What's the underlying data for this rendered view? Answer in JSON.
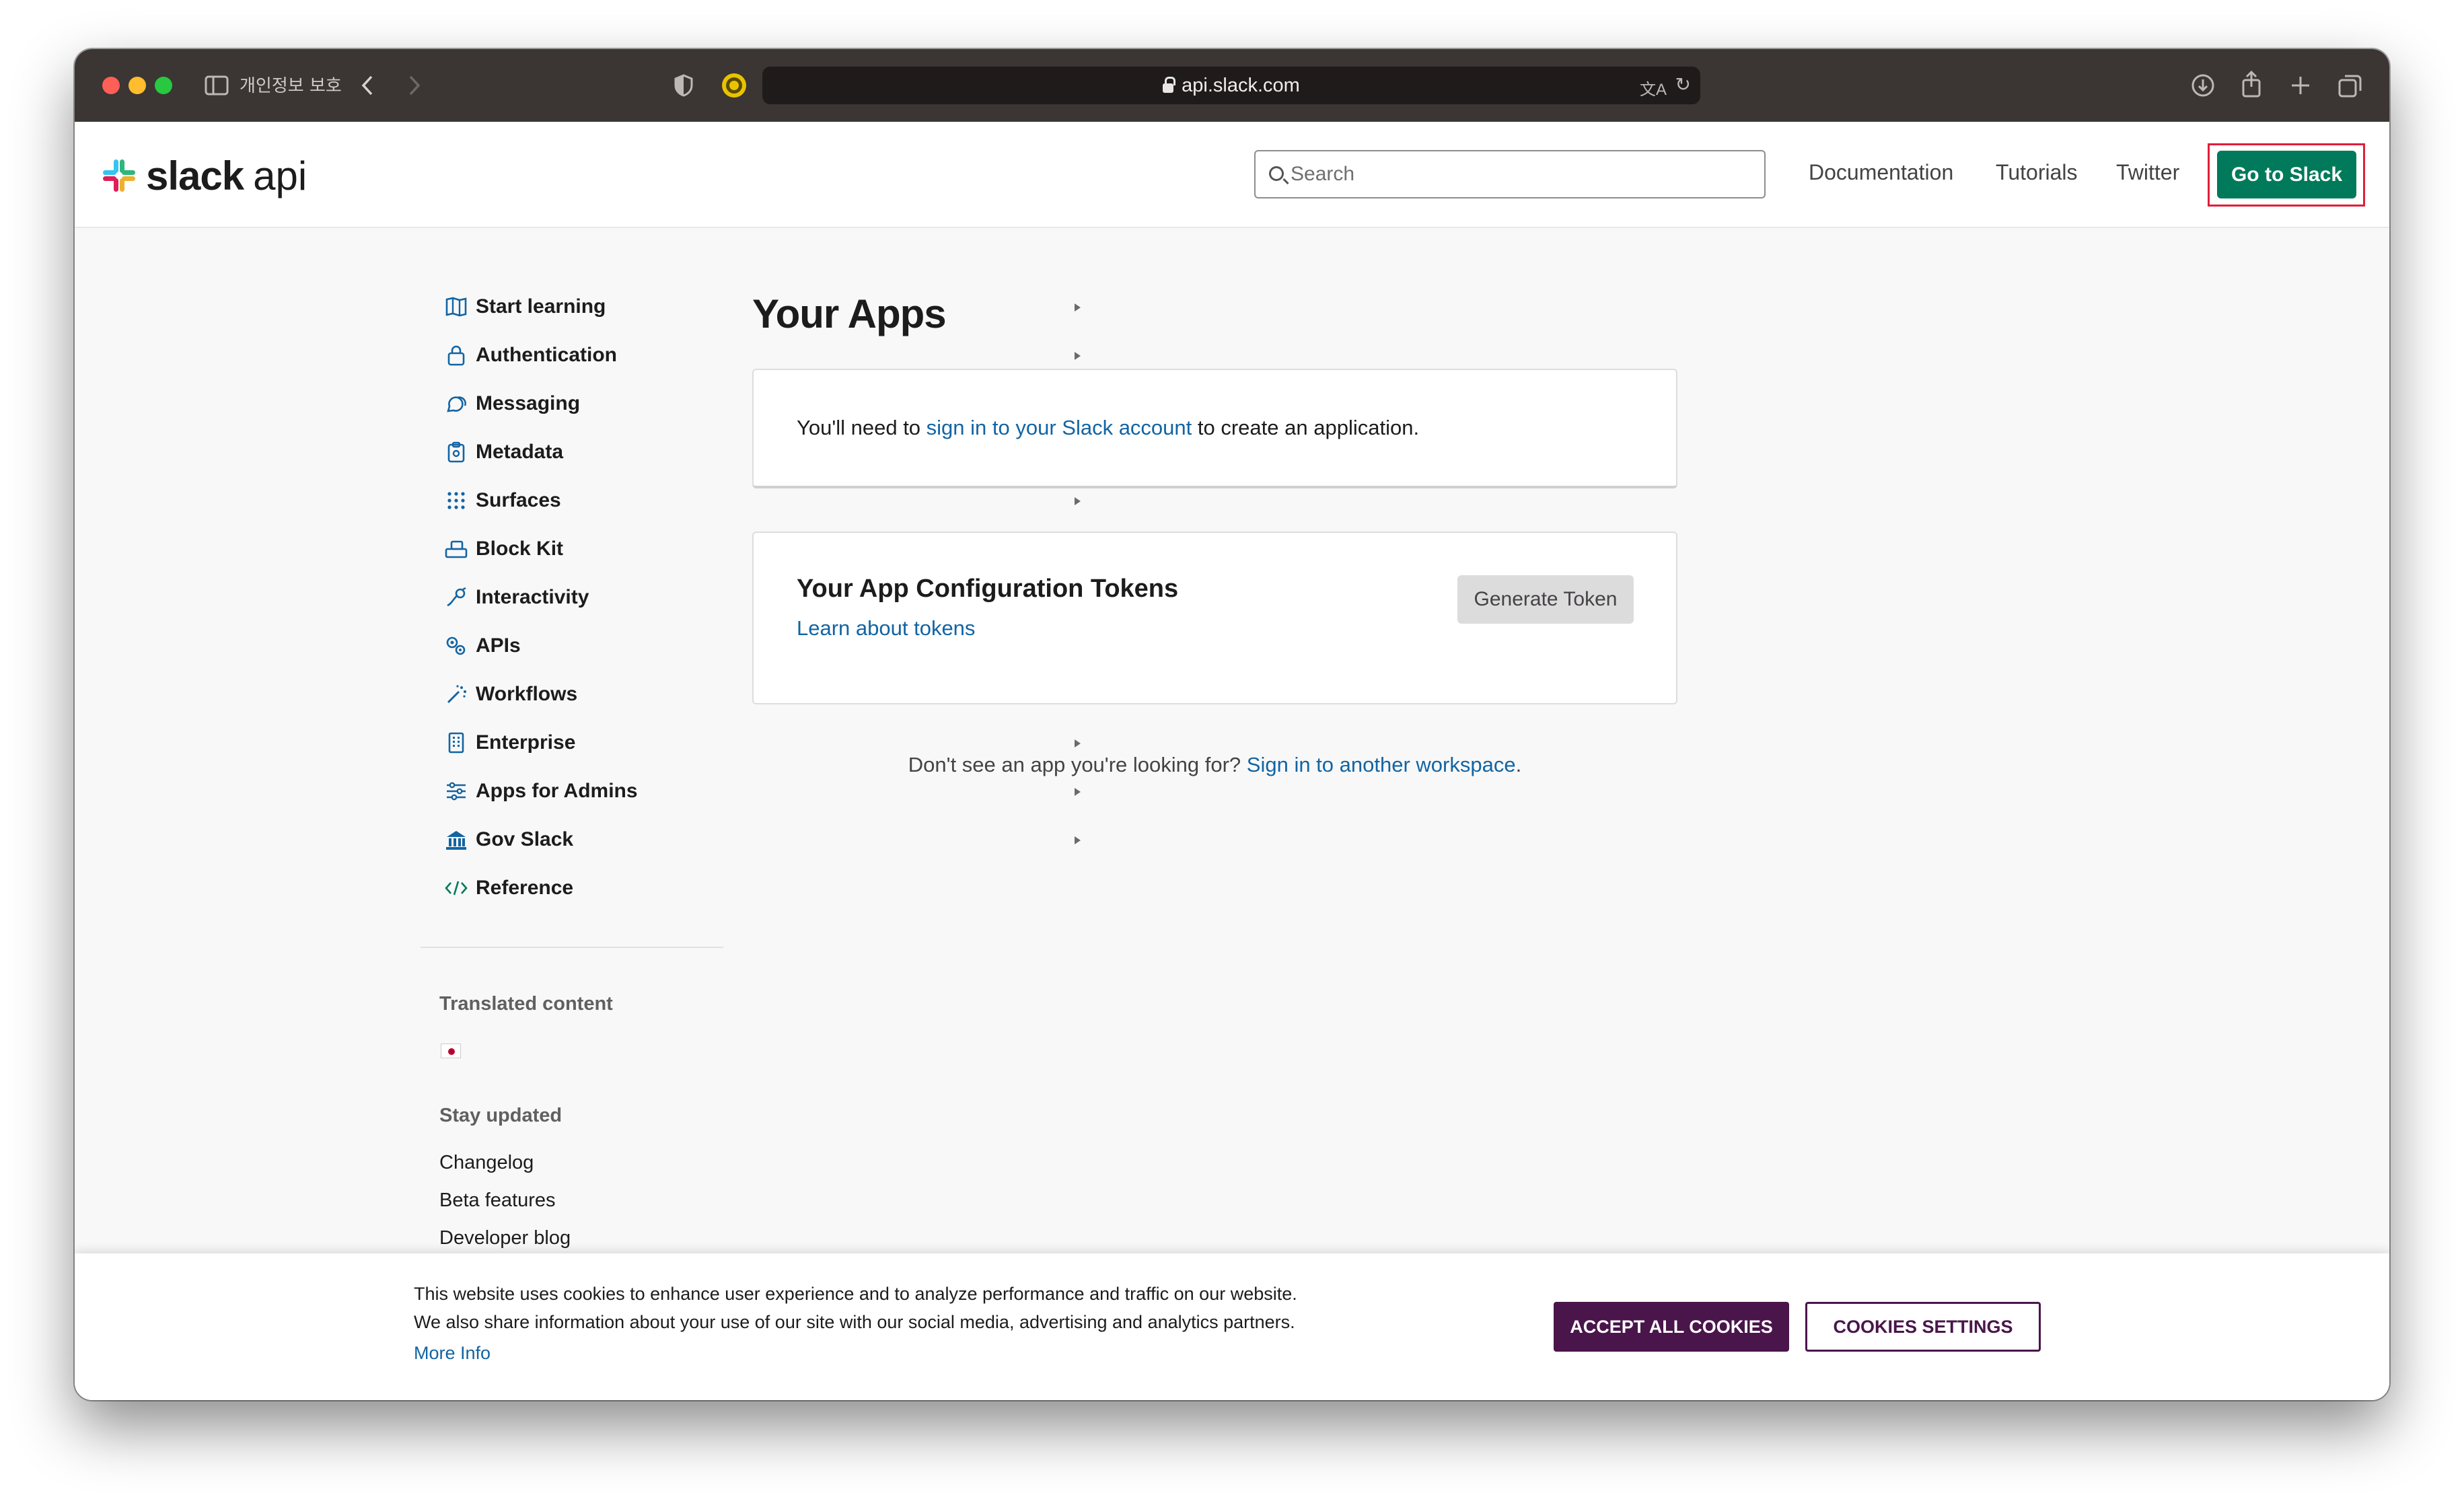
{
  "browser": {
    "privacy_label": "개인정보 보호",
    "url": "api.slack.com",
    "colors": {
      "close": "#ff5f57",
      "minimize": "#febc2e",
      "zoom": "#28c840",
      "titlebar": "#3b3533"
    }
  },
  "header": {
    "logo_word": "slack",
    "logo_suffix": "api",
    "search_placeholder": "Search",
    "nav": [
      "Documentation",
      "Tutorials",
      "Twitter"
    ],
    "cta_label": "Go to Slack",
    "cta_color": "#007a5a"
  },
  "sidebar": {
    "items": [
      {
        "label": "Start learning",
        "icon": "map-icon"
      },
      {
        "label": "Authentication",
        "icon": "lock-icon"
      },
      {
        "label": "Messaging",
        "icon": "chat-bubbles-icon"
      },
      {
        "label": "Metadata",
        "icon": "clipboard-icon"
      },
      {
        "label": "Surfaces",
        "icon": "grid-dots-icon"
      },
      {
        "label": "Block Kit",
        "icon": "blocks-icon"
      },
      {
        "label": "Interactivity",
        "icon": "pointer-icon"
      },
      {
        "label": "APIs",
        "icon": "gears-icon"
      },
      {
        "label": "Workflows",
        "icon": "magic-wand-icon"
      },
      {
        "label": "Enterprise",
        "icon": "building-icon"
      },
      {
        "label": "Apps for Admins",
        "icon": "sliders-icon"
      },
      {
        "label": "Gov Slack",
        "icon": "government-icon"
      },
      {
        "label": "Reference",
        "icon": "code-icon"
      }
    ],
    "translated_heading": "Translated content",
    "stay_updated_heading": "Stay updated",
    "stay_updated_links": [
      "Changelog",
      "Beta features",
      "Developer blog"
    ]
  },
  "main": {
    "title": "Your Apps",
    "signin_prefix": "You'll need to ",
    "signin_link": "sign in to your Slack account",
    "signin_suffix": " to create an application.",
    "tokens_title": "Your App Configuration Tokens",
    "tokens_link": "Learn about tokens",
    "generate_button": "Generate Token",
    "dontsee_prefix": "Don't see an app you're looking for? ",
    "dontsee_link": "Sign in to another workspace",
    "dontsee_suffix": "."
  },
  "cookie_banner": {
    "line1": "This website uses cookies to enhance user experience and to analyze performance and traffic on our website.",
    "line2": "We also share information about your use of our site with our social media, advertising and analytics partners.",
    "more_info": "More Info",
    "accept_label": "ACCEPT ALL COOKIES",
    "settings_label": "COOKIES SETTINGS",
    "accent_color": "#4a154b"
  }
}
